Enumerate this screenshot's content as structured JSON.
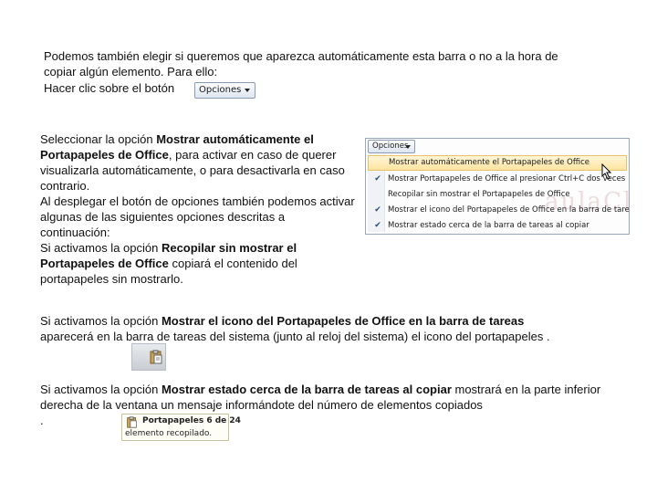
{
  "intro": {
    "line1": "Podemos también elegir si queremos que aparezca automáticamente esta barra o no a la hora de",
    "line2": "copiar algún elemento. Para ello:",
    "line3": "Hacer clic sobre el botón"
  },
  "options_button": {
    "label": "Opciones"
  },
  "section1": {
    "t1": "Seleccionar la opción ",
    "b1": "Mostrar automáticamente el Portapapeles de Office",
    "t2": ", para activar en caso de querer visualizarla automáticamente, o para desactivarla en caso contrario.",
    "t3": "Al desplegar el botón de opciones también podemos activar algunas de las siguientes opciones descritas a continuación:",
    "t4": "Si activamos la opción ",
    "b2": "Recopilar sin mostrar el Portapapeles de Office",
    "t5": " copiará el contenido del portapapeles sin mostrarlo."
  },
  "menu": {
    "button_label": "Opciones",
    "items": [
      {
        "label": "Mostrar automáticamente el Portapapeles de Office",
        "checked": false,
        "highlighted": true
      },
      {
        "label": "Mostrar Portapapeles de Office al presionar Ctrl+C dos veces",
        "checked": true,
        "highlighted": false
      },
      {
        "label": "Recopilar sin mostrar el Portapapeles de Office",
        "checked": false,
        "highlighted": false
      },
      {
        "label": "Mostrar el icono del Portapapeles de Office en la barra de tareas",
        "checked": true,
        "highlighted": false
      },
      {
        "label": "Mostrar estado cerca de la barra de tareas al copiar",
        "checked": true,
        "highlighted": false
      }
    ],
    "watermark": "aulaClic"
  },
  "section2": {
    "t1": "Si activamos la opción ",
    "b1": "Mostrar el icono del Portapapeles de Office en la barra de tareas",
    "t2": " aparecerá en la barra de tareas del sistema (junto al reloj del sistema) el icono del portapapeles  ."
  },
  "section3": {
    "t1": "Si activamos la opción ",
    "b1": "Mostrar estado cerca de la barra de tareas al copiar",
    "t2": " mostrará en la parte inferior derecha de la ventana un mensaje informándote del número de elementos copiados",
    "t3": "."
  },
  "notification": {
    "title": "Portapapeles 6 de 24",
    "message": "elemento recopilado."
  }
}
